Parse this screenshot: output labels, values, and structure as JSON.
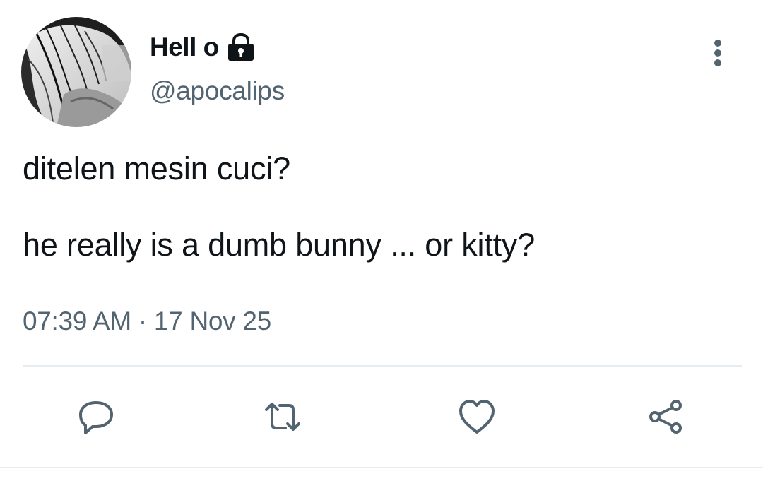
{
  "author": {
    "display_name": "Hell o",
    "handle": "@apocalips",
    "avatar_icon": "avatar-photo",
    "protected_icon": "lock-icon"
  },
  "tweet": {
    "lines": [
      "ditelen mesin cuci?",
      "",
      "he really is a dumb bunny ... or kitty?"
    ],
    "timestamp": "07:39 AM · 17 Nov 25"
  },
  "menu": {
    "icon": "more-vertical-icon"
  },
  "actions": [
    {
      "name": "reply",
      "icon": "reply-icon"
    },
    {
      "name": "retweet",
      "icon": "retweet-icon"
    },
    {
      "name": "like",
      "icon": "heart-icon"
    },
    {
      "name": "share",
      "icon": "share-icon"
    }
  ],
  "colors": {
    "text_primary": "#0f1419",
    "text_secondary": "#536471",
    "icon": "#536471",
    "divider": "#e6ecf0",
    "background": "#ffffff"
  }
}
